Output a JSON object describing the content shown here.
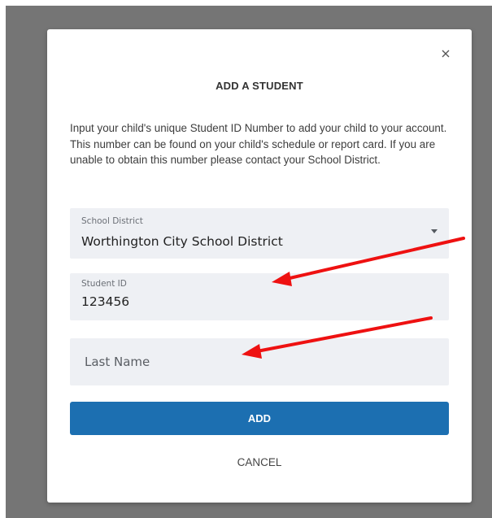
{
  "modal": {
    "title": "ADD A STUDENT",
    "description": "Input your child's unique Student ID Number to add your child to your account. This number can be found on your child's schedule or report card. If you are unable to obtain this number please contact your School District.",
    "close_icon": "close-icon"
  },
  "fields": {
    "district": {
      "label": "School District",
      "value": "Worthington City School District"
    },
    "student_id": {
      "label": "Student ID",
      "value": "123456"
    },
    "last_name": {
      "placeholder": "Last Name",
      "value": ""
    }
  },
  "buttons": {
    "add_label": "ADD",
    "cancel_label": "CANCEL"
  },
  "colors": {
    "primary_button": "#1c6fb1",
    "field_background": "#eef0f4",
    "overlay": "#757575",
    "annotation_arrow": "#ee1111"
  }
}
